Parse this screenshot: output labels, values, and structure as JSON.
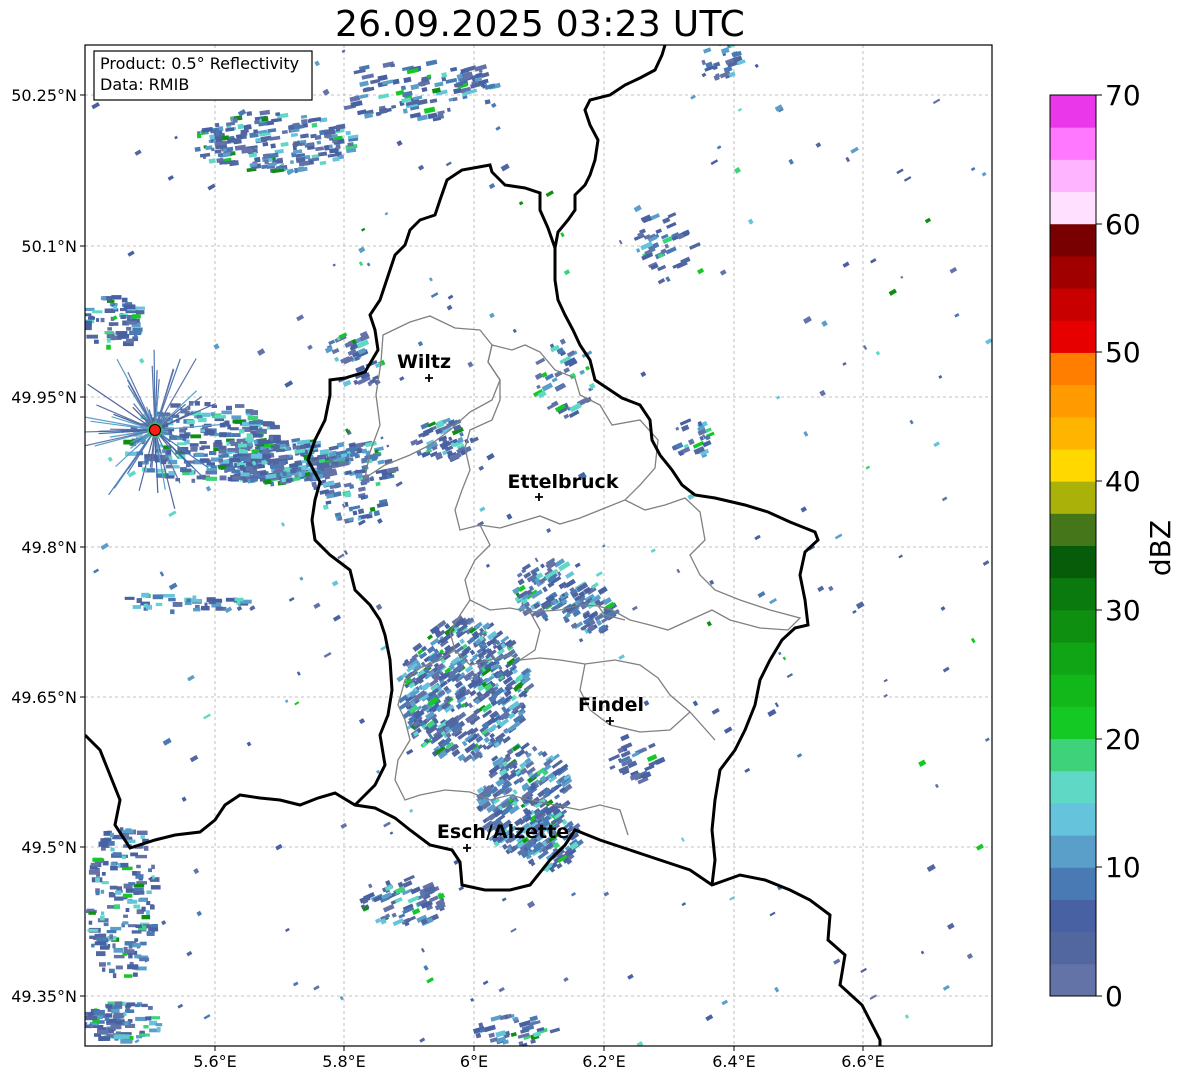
{
  "title": "26.09.2025 03:23 UTC",
  "info_box": {
    "product": "Product: 0.5° Reflectivity",
    "data_source": "Data: RMIB"
  },
  "axes": {
    "x_ticks": [
      "5.6°E",
      "5.8°E",
      "6°E",
      "6.2°E",
      "6.4°E",
      "6.6°E"
    ],
    "y_ticks": [
      "50.25°N",
      "50.1°N",
      "49.95°N",
      "49.8°N",
      "49.65°N",
      "49.5°N",
      "49.35°N"
    ]
  },
  "cities": [
    {
      "name": "Wiltz"
    },
    {
      "name": "Ettelbruck"
    },
    {
      "name": "Findel"
    },
    {
      "name": "Esch/Alzette"
    }
  ],
  "colorbar": {
    "label": "dBZ",
    "ticks": [
      "70",
      "60",
      "50",
      "40",
      "30",
      "20",
      "10",
      "0"
    ],
    "colors": [
      "#6373a8",
      "#52679f",
      "#4761a2",
      "#4a7ab4",
      "#5a9fca",
      "#65c3dc",
      "#60d8c6",
      "#3ed37a",
      "#15c925",
      "#12b81a",
      "#10a514",
      "#0f8f10",
      "#0b7a0e",
      "#075c0a",
      "#46761a",
      "#aab20a",
      "#ffd800",
      "#ffb400",
      "#ff9a00",
      "#ff7e00",
      "#e60000",
      "#c80000",
      "#a00000",
      "#780000",
      "#ffe0ff",
      "#ffb4ff",
      "#ff78ff",
      "#ea37ea"
    ]
  },
  "colors": {
    "border_country": "#000000",
    "border_canton": "#808080",
    "radar_site": "#ff1a1a",
    "grid": "#b0b0b0"
  }
}
